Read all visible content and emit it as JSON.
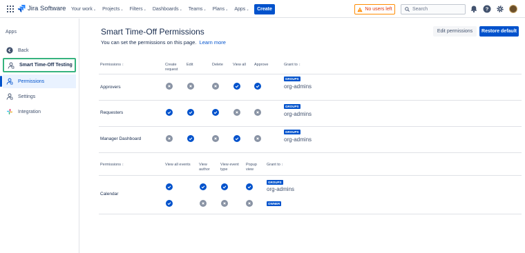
{
  "topbar": {
    "product": "Jira Software",
    "nav": [
      "Your work",
      "Projects",
      "Filters",
      "Dashboards",
      "Teams",
      "Plans",
      "Apps"
    ],
    "create_label": "Create",
    "warning_label": "No users left",
    "search_placeholder": "Search"
  },
  "sidebar": {
    "title": "Apps",
    "back": "Back",
    "app_name": "Smart Time-Off Testing",
    "items": [
      "Permissions",
      "Settings",
      "Integration"
    ]
  },
  "page": {
    "title": "Smart Time-Off Permissions",
    "subtitle": "You can set the permissions on this page.",
    "learn_more": "Learn more",
    "edit_button": "Edit permissions",
    "restore_button": "Restore default"
  },
  "table1": {
    "headers": [
      "Permissions",
      "Create request",
      "Edit",
      "Delete",
      "View all",
      "Approve",
      "Grant to"
    ],
    "rows": [
      {
        "label": "Approvers",
        "values": [
          false,
          false,
          false,
          true,
          true
        ],
        "group_badge": "GROUPS",
        "group": "org-admins"
      },
      {
        "label": "Requesters",
        "values": [
          true,
          true,
          true,
          false,
          false
        ],
        "group_badge": "GROUPS",
        "group": "org-admins"
      },
      {
        "label": "Manager Dashboard",
        "values": [
          false,
          true,
          false,
          true,
          false
        ],
        "group_badge": "GROUPS",
        "group": "org-admins"
      }
    ]
  },
  "table2": {
    "headers": [
      "Permissions",
      "View all events",
      "View author",
      "View event type",
      "Popup view",
      "Grant to"
    ],
    "row_label": "Calendar",
    "rows": [
      {
        "values": [
          true,
          true,
          true,
          true
        ],
        "badge": "GROUPS",
        "grant": "org-admins"
      },
      {
        "values": [
          true,
          false,
          false,
          false
        ],
        "badge": "OWNER",
        "grant": ""
      }
    ]
  },
  "colors": {
    "accent": "#0052cc",
    "disabled": "#8993a4",
    "highlight_border": "#36b37e",
    "warning": "#de350b"
  }
}
